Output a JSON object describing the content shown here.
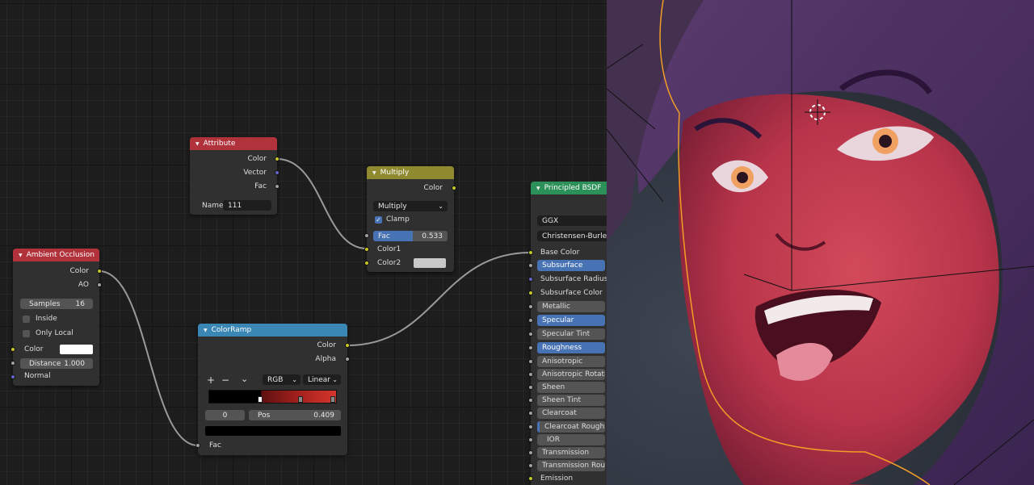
{
  "attribute": {
    "title": "Attribute",
    "outputs": [
      "Color",
      "Vector",
      "Fac"
    ],
    "name_label": "Name",
    "name_value": "111"
  },
  "multiply": {
    "title": "Multiply",
    "output": "Color",
    "op": "Multiply",
    "clamp": "Clamp",
    "fac_label": "Fac",
    "fac_value": "0.533",
    "inputs": [
      "Color1",
      "Color2"
    ]
  },
  "ao": {
    "title": "Ambient Occlusion",
    "outputs": [
      "Color",
      "AO"
    ],
    "samples_label": "Samples",
    "samples_value": "16",
    "inside": "Inside",
    "only_local": "Only Local",
    "color": "Color",
    "distance_label": "Distance",
    "distance_value": "1.000",
    "normal": "Normal"
  },
  "ramp": {
    "title": "ColorRamp",
    "outputs": [
      "Color",
      "Alpha"
    ],
    "plus": "+",
    "minus": "−",
    "menu": "⌄",
    "mode": "RGB",
    "interp": "Linear",
    "index": "0",
    "pos_label": "Pos",
    "pos_value": "0.409",
    "fac": "Fac"
  },
  "bsdf": {
    "title": "Principled BSDF",
    "dist": "GGX",
    "sss": "Christensen-Burley",
    "inputs": [
      "Base Color",
      "Subsurface",
      "Subsurface Radius",
      "Subsurface Color",
      "Metallic",
      "Specular",
      "Specular Tint",
      "Roughness",
      "Anisotropic",
      "Anisotropic Rotation",
      "Sheen",
      "Sheen Tint",
      "Clearcoat",
      "Clearcoat Roughness",
      "IOR",
      "Transmission",
      "Transmission Roughness",
      "Emission"
    ]
  },
  "colors": {
    "attr_header": "#b2323b",
    "mult_header": "#8f8a30",
    "ao_header": "#b2323b",
    "ramp_header": "#3a86b4",
    "bsdf_header": "#2c9158",
    "accent": "#4772b3",
    "selection_outline": "#f29d26"
  }
}
